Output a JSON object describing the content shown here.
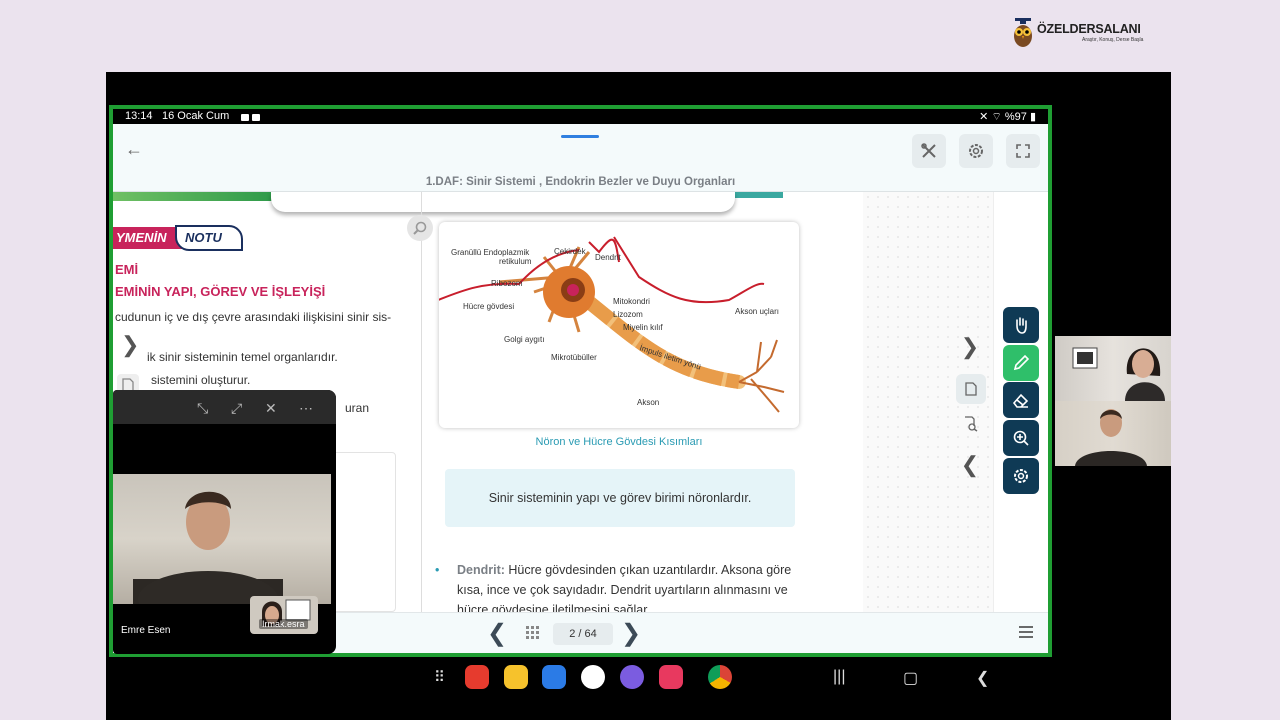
{
  "brand": {
    "name": "ÖZELDERSALANI",
    "tagline": "Araştır, Konuş, Derse Başla"
  },
  "statusbar": {
    "time": "13:14",
    "date": "16 Ocak Cum",
    "battery": "%97"
  },
  "header": {
    "title": "1.DAF: Sinir Sistemi , Endokrin Bezler ve Duyu Organları"
  },
  "left_page": {
    "badge_left": "YMENİN",
    "badge_right": "NOTU",
    "heading1": "EMİ",
    "heading2": "EMİNİN YAPI, GÖREV VE İŞLEYİŞİ",
    "line1": "cudunun iç ve dış çevre arasındaki ilişkisini sinir sis-",
    "line2": "ik sinir sisteminin temel organlarıdır.",
    "line3": "sistemini oluşturur.",
    "line4": "uran"
  },
  "figure": {
    "labels": {
      "er": "Granüllü Endoplazmik",
      "er2": "retikulum",
      "cekirdek": "Çekirdek",
      "dendrit": "Dendrit",
      "ribozom": "Ribozom",
      "hucre_govdesi": "Hücre gövdesi",
      "mitokondri": "Mitokondri",
      "lizozom": "Lizozom",
      "miyelin": "Miyelin kılıf",
      "golgi": "Golgi aygıtı",
      "impuls": "İmpuls iletim yönü",
      "mikrotubul": "Mikrotübüller",
      "akson": "Akson",
      "akson_uclari": "Akson uçları"
    },
    "caption": "Nöron ve Hücre Gövdesi Kısımları"
  },
  "infobox": {
    "text": "Sinir sisteminin yapı ve görev birimi nöronlardır."
  },
  "bullet": {
    "term": "Dendrit:",
    "text": " Hücre gövdesinden çıkan uzantılardır. Aksona göre kısa, ince ve çok sayıdadır. Dendrit uyartıların alınmasını ve hücre gövdesine iletilmesini sağlar."
  },
  "pager": {
    "label": "2 / 64"
  },
  "video_popup": {
    "participant": "Emre Esen",
    "thumb_name": "Irmak.esra"
  },
  "colors": {
    "frame": "#1f9e33",
    "accent": "#c8235b",
    "tool_dark": "#0f3a55",
    "tool_active": "#2fbf6a"
  }
}
